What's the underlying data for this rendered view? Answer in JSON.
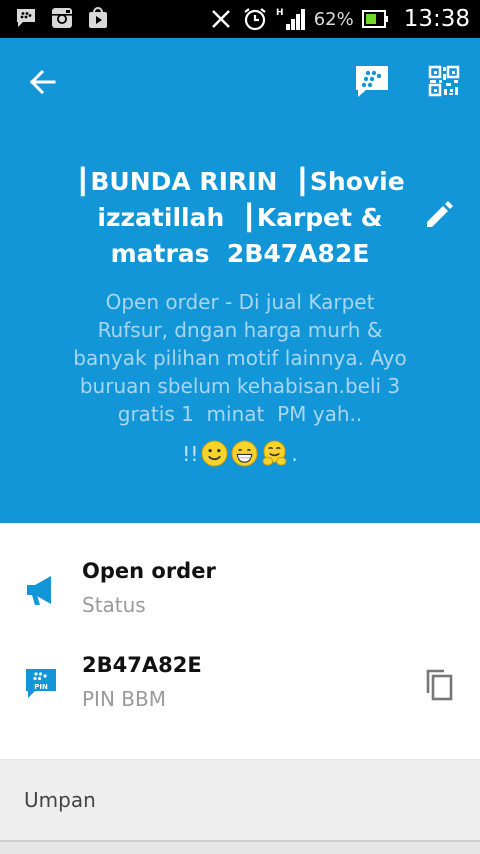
{
  "status_bar": {
    "battery_percent": "62%",
    "time": "13:38",
    "icons": [
      "bbm-notification-icon",
      "instagram-icon",
      "shopping-bag-icon",
      "mute-icon",
      "alarm-icon",
      "signal-icon",
      "battery-icon"
    ]
  },
  "header": {
    "background": "#1396d7",
    "profile_name": "┃BUNDA RIRIN  ┃Shovie\nizzatillah  ┃Karpet &\nmatras  2B47A82E",
    "status_message": "Open order - Di jual Karpet\nRufsur, dngan harga murh &\nbanyak pilihan motif lainnya. Ayo\nburuan sbelum kehabisan.beli 3\ngratis 1  minat  PM yah..",
    "status_suffix_prefix": "!!",
    "status_suffix_end": ".",
    "status_emojis": [
      "smiley-emoji",
      "grinning-emoji",
      "hugging-emoji"
    ]
  },
  "details": {
    "status": {
      "value": "Open order",
      "label": "Status"
    },
    "pin": {
      "value": "2B47A82E",
      "label": "PIN BBM",
      "pin_icon_text": "PIN"
    }
  },
  "feed": {
    "label": "Umpan"
  }
}
